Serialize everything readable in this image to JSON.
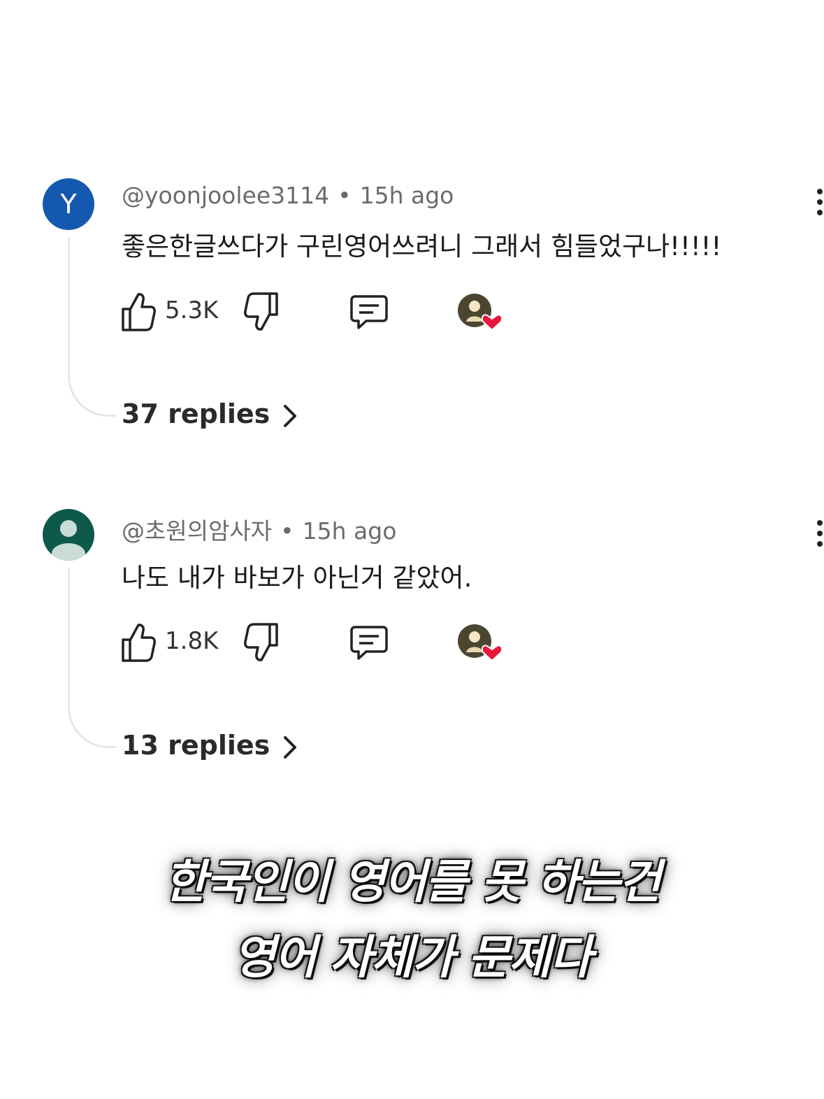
{
  "comments": [
    {
      "avatar_letter": "Y",
      "avatar_color": "#1558b0",
      "handle": "@yoonjoolee3114",
      "separator": "•",
      "time": "15h ago",
      "text": "좋은한글쓰다가 구린영어쓰려니 그래서 힘들었구나!!!!!",
      "likes": "5.3K",
      "replies": "37 replies",
      "icons": [
        "thumbs-up-icon",
        "thumbs-down-icon",
        "reply-icon",
        "creator-heart-icon",
        "more-vert-icon",
        "chevron-right-icon"
      ]
    },
    {
      "avatar_letter": "",
      "avatar_color": "#0e5a4a",
      "handle": "@초원의암사자",
      "separator": "•",
      "time": "15h ago",
      "text": "나도 내가 바보가 아닌거 같았어.",
      "likes": "1.8K",
      "replies": "13 replies",
      "icons": [
        "thumbs-up-icon",
        "thumbs-down-icon",
        "reply-icon",
        "creator-heart-icon",
        "more-vert-icon",
        "chevron-right-icon"
      ]
    }
  ],
  "caption": {
    "line1": "한국인이 영어를 못 하는건",
    "line2": "영어 자체가 문제다"
  },
  "colors": {
    "heart": "#e8173c",
    "meta_text": "#6b6b6b",
    "connector": "#e6e6e6"
  }
}
